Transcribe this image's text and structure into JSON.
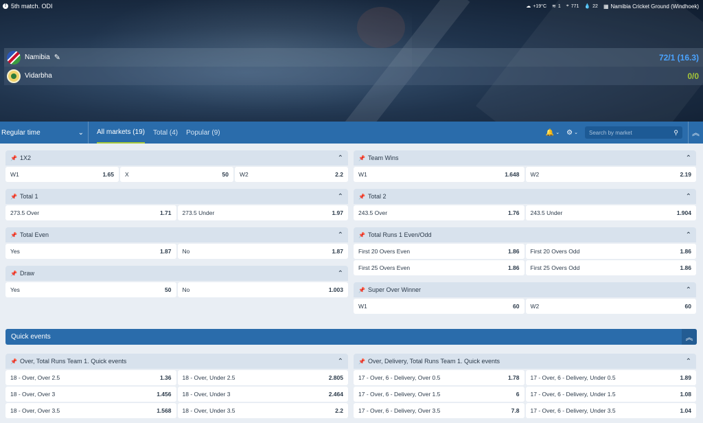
{
  "header": {
    "match_title": "5th match. ODI",
    "weather": "+19°C",
    "wind": "1",
    "location_code": "771",
    "humidity": "22",
    "ground": "Namibia Cricket Ground (Windhoek)"
  },
  "teams": [
    {
      "name": "Namibia",
      "score": "72/1 (16.3)",
      "batting": true
    },
    {
      "name": "Vidarbha",
      "score": "0/0",
      "batting": false
    }
  ],
  "nav": {
    "period": "Regular time",
    "tabs": [
      {
        "label": "All markets (19)",
        "active": true
      },
      {
        "label": "Total (4)",
        "active": false
      },
      {
        "label": "Popular (9)",
        "active": false
      }
    ],
    "search_placeholder": "Search by market"
  },
  "markets_left": [
    {
      "title": "1X2",
      "rows": [
        [
          [
            "W1",
            "1.65"
          ],
          [
            "X",
            "50"
          ],
          [
            "W2",
            "2.2"
          ]
        ]
      ]
    },
    {
      "title": "Total 1",
      "rows": [
        [
          [
            "273.5 Over",
            "1.71"
          ],
          [
            "273.5 Under",
            "1.97"
          ]
        ]
      ]
    },
    {
      "title": "Total Even",
      "rows": [
        [
          [
            "Yes",
            "1.87"
          ],
          [
            "No",
            "1.87"
          ]
        ]
      ]
    },
    {
      "title": "Draw",
      "rows": [
        [
          [
            "Yes",
            "50"
          ],
          [
            "No",
            "1.003"
          ]
        ]
      ]
    }
  ],
  "markets_right": [
    {
      "title": "Team Wins",
      "rows": [
        [
          [
            "W1",
            "1.648"
          ],
          [
            "W2",
            "2.19"
          ]
        ]
      ]
    },
    {
      "title": "Total 2",
      "rows": [
        [
          [
            "243.5 Over",
            "1.76"
          ],
          [
            "243.5 Under",
            "1.904"
          ]
        ]
      ]
    },
    {
      "title": "Total Runs 1 Even/Odd",
      "rows": [
        [
          [
            "First 20 Overs Even",
            "1.86"
          ],
          [
            "First 20 Overs Odd",
            "1.86"
          ]
        ],
        [
          [
            "First 25 Overs Even",
            "1.86"
          ],
          [
            "First 25 Overs Odd",
            "1.86"
          ]
        ]
      ]
    },
    {
      "title": "Super Over Winner",
      "rows": [
        [
          [
            "W1",
            "60"
          ],
          [
            "W2",
            "60"
          ]
        ]
      ]
    }
  ],
  "quick_events": {
    "label": "Quick events",
    "left": {
      "title": "Over, Total Runs Team 1. Quick events",
      "rows": [
        [
          [
            "18 - Over, Over 2.5",
            "1.36"
          ],
          [
            "18 - Over, Under 2.5",
            "2.805"
          ]
        ],
        [
          [
            "18 - Over, Over 3",
            "1.456"
          ],
          [
            "18 - Over, Under 3",
            "2.464"
          ]
        ],
        [
          [
            "18 - Over, Over 3.5",
            "1.568"
          ],
          [
            "18 - Over, Under 3.5",
            "2.2"
          ]
        ]
      ]
    },
    "right": {
      "title": "Over, Delivery, Total Runs Team 1. Quick events",
      "rows": [
        [
          [
            "17 - Over, 6 - Delivery, Over 0.5",
            "1.78"
          ],
          [
            "17 - Over, 6 - Delivery, Under 0.5",
            "1.89"
          ]
        ],
        [
          [
            "17 - Over, 6 - Delivery, Over 1.5",
            "6"
          ],
          [
            "17 - Over, 6 - Delivery, Under 1.5",
            "1.08"
          ]
        ],
        [
          [
            "17 - Over, 6 - Delivery, Over 3.5",
            "7.8"
          ],
          [
            "17 - Over, 6 - Delivery, Under 3.5",
            "1.04"
          ]
        ]
      ]
    }
  }
}
